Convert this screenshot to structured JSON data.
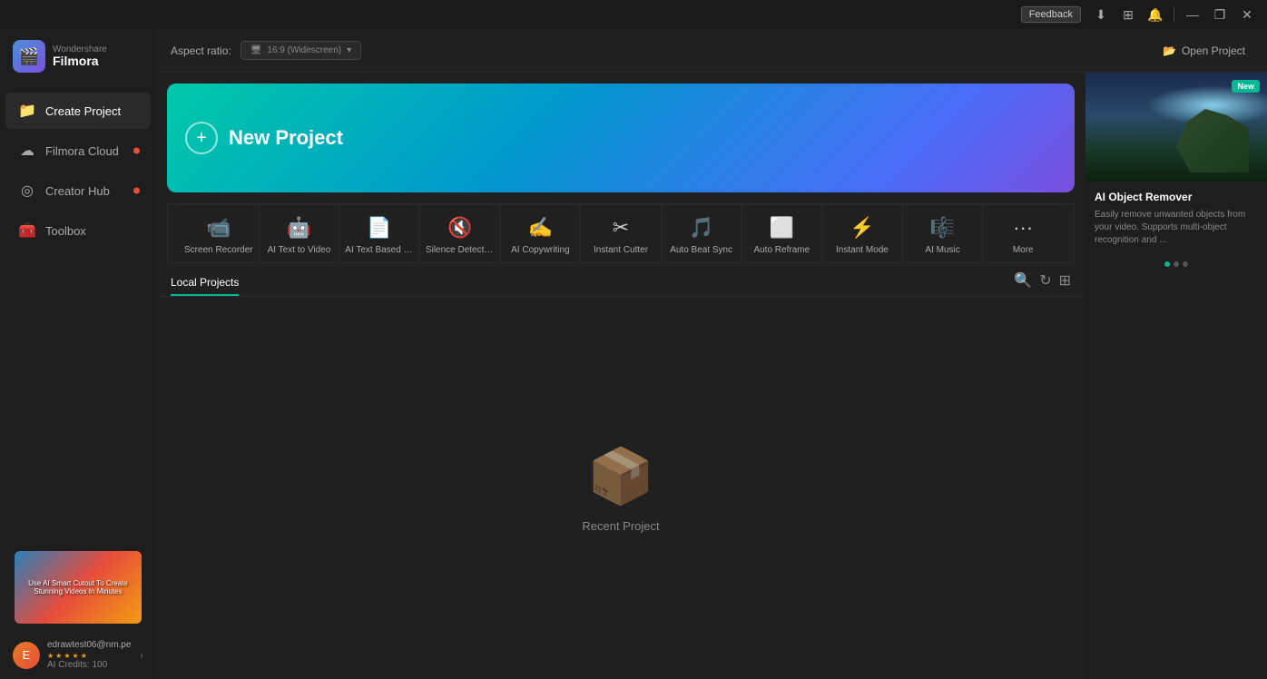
{
  "app": {
    "brand": "Wondershare",
    "name": "Filmora"
  },
  "titlebar": {
    "feedback_label": "Feedback",
    "buttons": [
      "download",
      "grid",
      "notification",
      "minimize",
      "maximize",
      "close"
    ]
  },
  "sidebar": {
    "items": [
      {
        "id": "create-project",
        "label": "Create Project",
        "icon": "📁",
        "active": true,
        "dot": false
      },
      {
        "id": "filmora-cloud",
        "label": "Filmora Cloud",
        "icon": "☁",
        "active": false,
        "dot": true
      },
      {
        "id": "creator-hub",
        "label": "Creator Hub",
        "icon": "◎",
        "active": false,
        "dot": true
      },
      {
        "id": "toolbox",
        "label": "Toolbox",
        "icon": "🧰",
        "active": false,
        "dot": false
      }
    ],
    "thumbnail_alt": "AI Smart Cutout tutorial thumbnail",
    "user": {
      "email": "edrawtest06@nm.pe",
      "credits_label": "AI Credits: 100",
      "avatar_letter": "E"
    }
  },
  "topbar": {
    "aspect_ratio_label": "Aspect ratio:",
    "aspect_ratio_icon": "🖥",
    "aspect_ratio_value": "16:9 (Widescreen)",
    "open_project_label": "Open Project"
  },
  "banner": {
    "icon": "+",
    "title": "New Project"
  },
  "quick_actions": [
    {
      "id": "screen-recorder",
      "label": "Screen Recorder",
      "icon": "📹"
    },
    {
      "id": "ai-text-to-video",
      "label": "AI Text to Video",
      "icon": "🎬"
    },
    {
      "id": "ai-text-based-editing",
      "label": "AI Text Based Editi...",
      "icon": "✏"
    },
    {
      "id": "silence-detection",
      "label": "Silence Detection",
      "icon": "🔇"
    },
    {
      "id": "ai-copywriting",
      "label": "AI Copywriting",
      "icon": "📝"
    },
    {
      "id": "instant-cutter",
      "label": "Instant Cutter",
      "icon": "✂"
    },
    {
      "id": "auto-beat-sync",
      "label": "Auto Beat Sync",
      "icon": "🎵"
    },
    {
      "id": "auto-reframe",
      "label": "Auto Reframe",
      "icon": "⬜"
    },
    {
      "id": "instant-mode",
      "label": "Instant Mode",
      "icon": "⚡"
    },
    {
      "id": "ai-music",
      "label": "AI Music",
      "icon": "🎼"
    },
    {
      "id": "more",
      "label": "More",
      "icon": "•••"
    }
  ],
  "local_projects": {
    "tab_label": "Local Projects",
    "empty_label": "Recent Project"
  },
  "right_panel": {
    "badge": "New",
    "card_title": "AI Object Remover",
    "card_desc": "Easily remove unwanted objects from your video. Supports multi-object recognition and ...",
    "dots": [
      {
        "active": true
      },
      {
        "active": false
      },
      {
        "active": false
      }
    ]
  }
}
